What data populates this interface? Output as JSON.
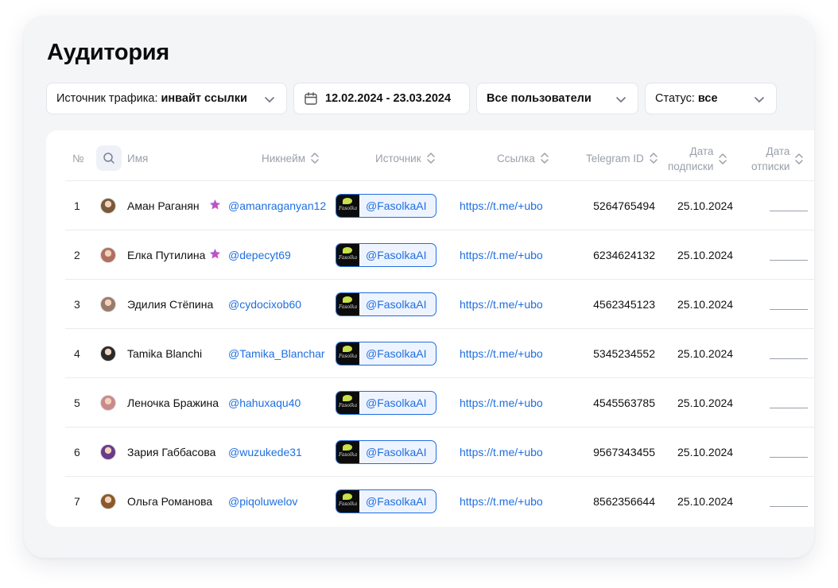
{
  "title": "Аудитория",
  "filters": {
    "traffic_label": "Источник трафика:",
    "traffic_value": "инвайт ссылки",
    "date_range": "12.02.2024 - 23.03.2024",
    "users": "Все пользователи",
    "status_label": "Статус:",
    "status_value": "все"
  },
  "columns": {
    "num": "№",
    "name": "Имя",
    "nickname": "Никнейм",
    "source": "Источник",
    "link": "Ссылка",
    "telegram_id": "Telegram ID",
    "sub_date_1": "Дата",
    "sub_date_2": "подписки",
    "unsub_date_1": "Дата",
    "unsub_date_2": "отписки"
  },
  "colors": {
    "accent": "#1f6fe0",
    "star_a": "#8b5cf6",
    "star_b": "#ec4899"
  },
  "rows": [
    {
      "num": "1",
      "name": "Аман Раганян",
      "star": true,
      "nick": "@amanraganyan12",
      "source": "@FasolkaAI",
      "link": "https://t.me/+ubo",
      "tgid": "5264765494",
      "sub": "25.10.2024",
      "avatar": "#7a5a3a"
    },
    {
      "num": "2",
      "name": "Елка Путилина",
      "star": true,
      "nick": "@depecyt69",
      "source": "@FasolkaAI",
      "link": "https://t.me/+ubo",
      "tgid": "6234624132",
      "sub": "25.10.2024",
      "avatar": "#b07060"
    },
    {
      "num": "3",
      "name": "Эдилия Стёпина",
      "star": false,
      "nick": "@cydocixob60",
      "source": "@FasolkaAI",
      "link": "https://t.me/+ubo",
      "tgid": "4562345123",
      "sub": "25.10.2024",
      "avatar": "#9a7a6a"
    },
    {
      "num": "4",
      "name": "Tamika Blanchi",
      "star": false,
      "nick": "@Tamika_Blanchar",
      "source": "@FasolkaAI",
      "link": "https://t.me/+ubo",
      "tgid": "5345234552",
      "sub": "25.10.2024",
      "avatar": "#2a2a2a"
    },
    {
      "num": "5",
      "name": "Леночка Бражина",
      "star": false,
      "nick": "@hahuxaqu40",
      "source": "@FasolkaAI",
      "link": "https://t.me/+ubo",
      "tgid": "4545563785",
      "sub": "25.10.2024",
      "avatar": "#c98a8a"
    },
    {
      "num": "6",
      "name": "Зария Габбасова",
      "star": false,
      "nick": "@wuzukede31",
      "source": "@FasolkaAI",
      "link": "https://t.me/+ubo",
      "tgid": "9567343455",
      "sub": "25.10.2024",
      "avatar": "#6a3a8a"
    },
    {
      "num": "7",
      "name": "Ольга Романова",
      "star": false,
      "nick": "@piqoluwelov",
      "source": "@FasolkaAI",
      "link": "https://t.me/+ubo",
      "tgid": "8562356644",
      "sub": "25.10.2024",
      "avatar": "#8a5a2a"
    }
  ]
}
